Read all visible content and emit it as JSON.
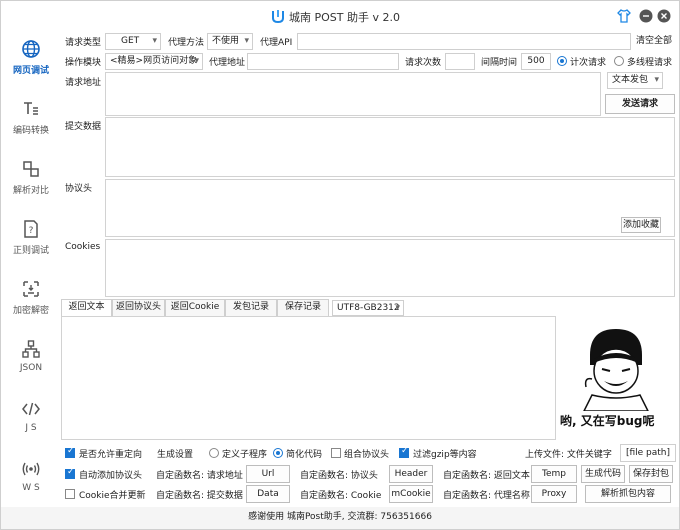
{
  "titlebar": {
    "title": "城南 POST 助手 v 2.0"
  },
  "sidebar": {
    "items": [
      {
        "label": "网页调试",
        "icon": "globe-icon"
      },
      {
        "label": "编码转换",
        "icon": "text-format-icon"
      },
      {
        "label": "解析对比",
        "icon": "compare-icon"
      },
      {
        "label": "正则调试",
        "icon": "regex-icon"
      },
      {
        "label": "加密解密",
        "icon": "encrypt-icon"
      },
      {
        "label": "JSON",
        "icon": "tree-icon"
      },
      {
        "label": "J S",
        "icon": "code-icon"
      },
      {
        "label": "W S",
        "icon": "websocket-icon"
      }
    ]
  },
  "form": {
    "method_label": "请求类型",
    "method_value": "GET",
    "proxy_method_label": "代理方法",
    "proxy_method_value": "不使用",
    "proxy_api_label": "代理API",
    "clear_all": "清空全部",
    "module_label": "操作模块",
    "module_value": "<精易>网页访问对象",
    "proxy_addr_label": "代理地址",
    "req_count_label": "请求次数",
    "interval_label": "间隔时间",
    "interval_value": "500",
    "count_mode": "计次请求",
    "multi_thread": "多线程请求",
    "url_label": "请求地址",
    "send_mode": "文本发包",
    "send_btn": "发送请求",
    "post_label": "提交数据",
    "headers_label": "协议头",
    "add_fav": "添加收藏",
    "cookies_label": "Cookies"
  },
  "tabs": [
    "返回文本",
    "返回协议头",
    "返回Cookie",
    "发包记录",
    "保存记录"
  ],
  "encoding": "UTF8-GB2312",
  "meme": {
    "caption": "哟, 又在写bug呢"
  },
  "bottom": {
    "allow_redirect": "是否允许重定向",
    "gen_settings": "生成设置",
    "custom_program": "定义子程序",
    "simplify_code": "简化代码",
    "combine_headers": "组合协议头",
    "filter_gzip": "过滤gzip等内容",
    "upload_label": "上传文件: 文件关键字",
    "file_path": "[file path]",
    "auto_headers": "自动添加协议头",
    "func_url_label": "自定函数名: 请求地址",
    "func_url": "Url",
    "func_header_label": "自定函数名: 协议头",
    "func_header": "Header",
    "func_ret_label": "自定函数名: 返回文本",
    "func_ret": "Temp",
    "gen_code": "生成代码",
    "save_pkt": "保存封包",
    "cookie_merge": "Cookie合并更新",
    "func_data_label": "自定函数名: 提交数据",
    "func_data": "Data",
    "func_cookie_label": "自定函数名: Cookie",
    "func_cookie": "mCookie",
    "func_proxy_label": "自定函数名: 代理名称",
    "func_proxy": "Proxy",
    "parse_pkt": "解析抓包内容"
  },
  "status": "感谢使用 城南Post助手, 交流群: 756351666",
  "colors": {
    "accent": "#1976d2",
    "active_nav": "#1565c0"
  }
}
